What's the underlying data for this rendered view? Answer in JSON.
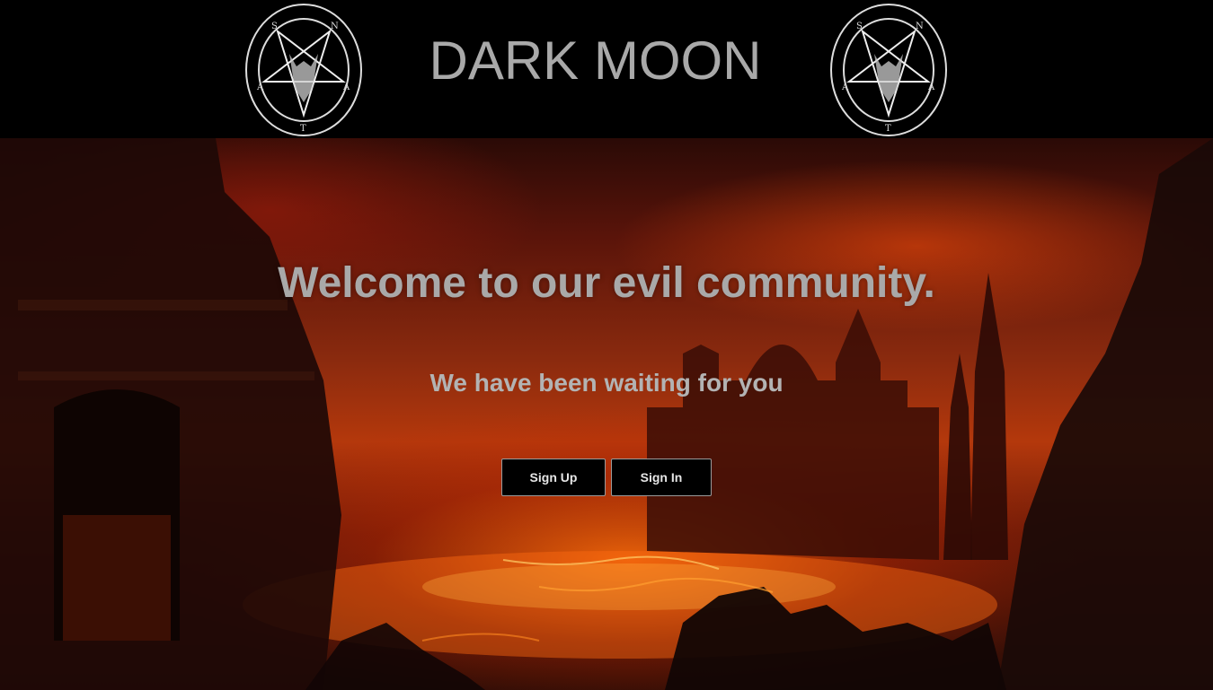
{
  "header": {
    "title": "DARK MOON",
    "emblem_letters": [
      "S",
      "A",
      "T",
      "A",
      "N"
    ]
  },
  "hero": {
    "heading": "Welcome to our evil community.",
    "subheading": "We have been waiting for you",
    "buttons": {
      "signup_label": "Sign Up",
      "signin_label": "Sign In"
    }
  },
  "icons": {
    "emblem": "sigil-of-baphomet-icon"
  },
  "colors": {
    "title": "#a9a9a9",
    "heading": "#a9a9a9",
    "button_bg": "#000000",
    "button_text": "#e6e6e6"
  }
}
